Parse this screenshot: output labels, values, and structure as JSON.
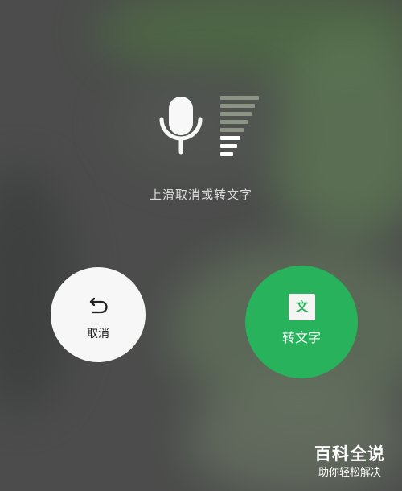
{
  "prompt": {
    "hint_text": "上滑取消或转文字"
  },
  "cancel": {
    "label": "取消",
    "icon": "undo-arrow-icon"
  },
  "convert": {
    "label": "转文字",
    "icon_text": "文"
  },
  "recording": {
    "icon": "microphone-icon",
    "level_icon": "volume-level-icon",
    "level_bars_total": 8,
    "level_bars_active": 3,
    "active_bar_color": "#ffffff",
    "inactive_bar_color": "#8c9585"
  },
  "watermark": {
    "title": "百科全说",
    "subtitle": "助你轻松解决"
  },
  "colors": {
    "convert_button": "#27b25b",
    "cancel_button": "#f7f7f7",
    "hint_text": "#d9dbd9"
  }
}
